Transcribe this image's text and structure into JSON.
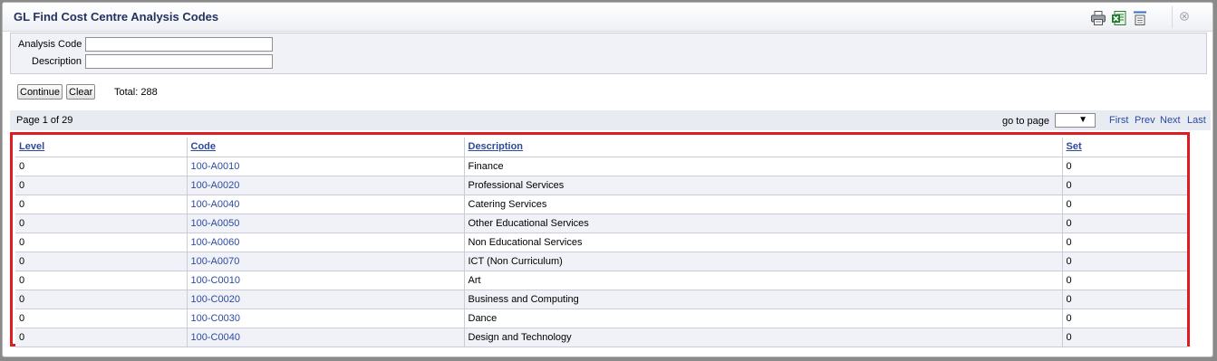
{
  "window": {
    "title": "GL Find Cost Centre Analysis Codes"
  },
  "toolbar": {
    "icons": [
      "print-icon",
      "excel-icon",
      "export-icon",
      "close-icon"
    ]
  },
  "filters": {
    "analysis_code_label": "Analysis Code",
    "analysis_code_value": "",
    "description_label": "Description",
    "description_value": ""
  },
  "actions": {
    "continue_label": "Continue",
    "clear_label": "Clear",
    "total_text": "Total: 288"
  },
  "pager": {
    "page_info": "Page 1 of 29",
    "goto_label": "go to page",
    "goto_arrow": "▼",
    "first": "First",
    "prev": "Prev",
    "next": "Next",
    "last": "Last"
  },
  "table": {
    "columns": [
      "Level",
      "Code",
      "Description",
      "Set"
    ],
    "rows": [
      {
        "level": "0",
        "code": "100-A0010",
        "description": "Finance",
        "set": "0"
      },
      {
        "level": "0",
        "code": "100-A0020",
        "description": "Professional Services",
        "set": "0"
      },
      {
        "level": "0",
        "code": "100-A0040",
        "description": "Catering Services",
        "set": "0"
      },
      {
        "level": "0",
        "code": "100-A0050",
        "description": "Other Educational Services",
        "set": "0"
      },
      {
        "level": "0",
        "code": "100-A0060",
        "description": "Non Educational Services",
        "set": "0"
      },
      {
        "level": "0",
        "code": "100-A0070",
        "description": "ICT (Non Curriculum)",
        "set": "0"
      },
      {
        "level": "0",
        "code": "100-C0010",
        "description": "Art",
        "set": "0"
      },
      {
        "level": "0",
        "code": "100-C0020",
        "description": "Business and Computing",
        "set": "0"
      },
      {
        "level": "0",
        "code": "100-C0030",
        "description": "Dance",
        "set": "0"
      },
      {
        "level": "0",
        "code": "100-C0040",
        "description": "Design and Technology",
        "set": "0"
      }
    ]
  },
  "colors": {
    "title": "#23325e",
    "link": "#2b4aa0",
    "highlight_border": "#e01b22"
  }
}
